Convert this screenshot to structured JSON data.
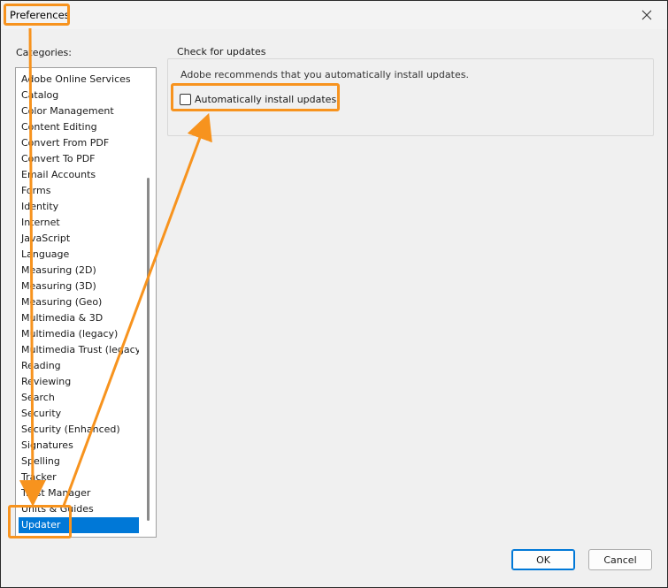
{
  "window": {
    "title": "Preferences"
  },
  "sidebar": {
    "label": "Categories:",
    "items": [
      {
        "label": "Adobe Online Services"
      },
      {
        "label": "Catalog"
      },
      {
        "label": "Color Management"
      },
      {
        "label": "Content Editing"
      },
      {
        "label": "Convert From PDF"
      },
      {
        "label": "Convert To PDF"
      },
      {
        "label": "Email Accounts"
      },
      {
        "label": "Forms"
      },
      {
        "label": "Identity"
      },
      {
        "label": "Internet"
      },
      {
        "label": "JavaScript"
      },
      {
        "label": "Language"
      },
      {
        "label": "Measuring (2D)"
      },
      {
        "label": "Measuring (3D)"
      },
      {
        "label": "Measuring (Geo)"
      },
      {
        "label": "Multimedia & 3D"
      },
      {
        "label": "Multimedia (legacy)"
      },
      {
        "label": "Multimedia Trust (legacy)"
      },
      {
        "label": "Reading"
      },
      {
        "label": "Reviewing"
      },
      {
        "label": "Search"
      },
      {
        "label": "Security"
      },
      {
        "label": "Security (Enhanced)"
      },
      {
        "label": "Signatures"
      },
      {
        "label": "Spelling"
      },
      {
        "label": "Tracker"
      },
      {
        "label": "Trust Manager"
      },
      {
        "label": "Units & Guides"
      },
      {
        "label": "Updater"
      }
    ],
    "selected": "Updater"
  },
  "updates": {
    "group_title": "Check for updates",
    "recommendation": "Adobe recommends that you automatically install updates.",
    "checkbox_label": "Automatically install updates",
    "checked": false
  },
  "footer": {
    "ok_label": "OK",
    "cancel_label": "Cancel"
  },
  "colors": {
    "highlight": "#f7931e",
    "selection": "#0078d7"
  }
}
